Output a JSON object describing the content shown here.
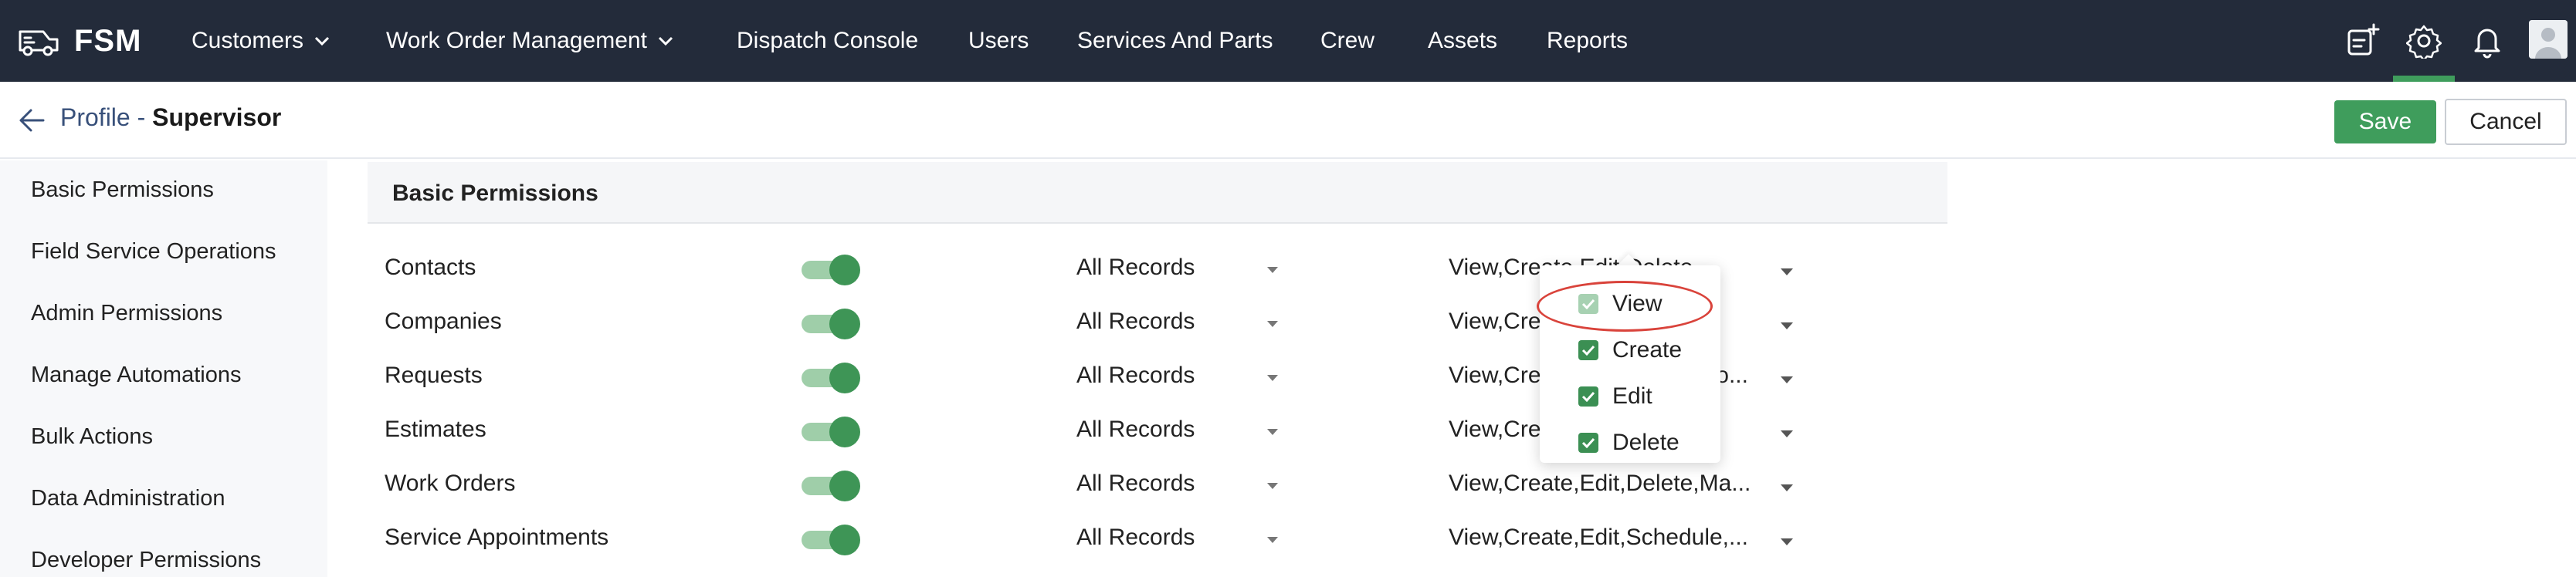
{
  "topnav": {
    "brand": "FSM",
    "items": [
      {
        "label": "Customers",
        "has_chevron": true
      },
      {
        "label": "Work Order Management",
        "has_chevron": true
      },
      {
        "label": "Dispatch Console",
        "has_chevron": false
      },
      {
        "label": "Users",
        "has_chevron": false
      },
      {
        "label": "Services And Parts",
        "has_chevron": false
      },
      {
        "label": "Crew",
        "has_chevron": false
      },
      {
        "label": "Assets",
        "has_chevron": false
      },
      {
        "label": "Reports",
        "has_chevron": false
      }
    ],
    "right_icons": [
      "create-record-icon",
      "gear-icon",
      "bell-icon",
      "user-avatar"
    ],
    "accent": "#3f9d5c",
    "background": "#232b3a"
  },
  "titlebar": {
    "profile_label": "Profile",
    "separator": " - ",
    "profile_name": "Supervisor",
    "save_label": "Save",
    "cancel_label": "Cancel"
  },
  "sidebar": {
    "items": [
      "Basic Permissions",
      "Field Service Operations",
      "Admin Permissions",
      "Manage Automations",
      "Bulk Actions",
      "Data Administration",
      "Developer Permissions"
    ]
  },
  "panel": {
    "title": "Basic Permissions",
    "rows": [
      {
        "module": "Contacts",
        "enabled": true,
        "records": "All Records",
        "permissions": "View,Create,Edit,Delete"
      },
      {
        "module": "Companies",
        "enabled": true,
        "records": "All Records",
        "permissions": "View,Create,Edit,Delete"
      },
      {
        "module": "Requests",
        "enabled": true,
        "records": "All Records",
        "permissions": "View,Create,Edit,Delete,Co..."
      },
      {
        "module": "Estimates",
        "enabled": true,
        "records": "All Records",
        "permissions": "View,Create,Edit,Delete"
      },
      {
        "module": "Work Orders",
        "enabled": true,
        "records": "All Records",
        "permissions": "View,Create,Edit,Delete,Ma..."
      },
      {
        "module": "Service Appointments",
        "enabled": true,
        "records": "All Records",
        "permissions": "View,Create,Edit,Schedule,..."
      }
    ]
  },
  "popup": {
    "options": [
      {
        "label": "View",
        "checked": true,
        "disabled": true
      },
      {
        "label": "Create",
        "checked": true,
        "disabled": false
      },
      {
        "label": "Edit",
        "checked": true,
        "disabled": false
      },
      {
        "label": "Delete",
        "checked": true,
        "disabled": false
      }
    ]
  }
}
